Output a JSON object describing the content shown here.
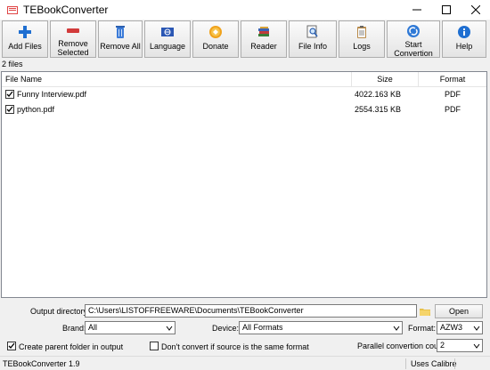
{
  "window": {
    "title": "TEBookConverter",
    "icons": [
      "app-icon",
      "minimize-icon",
      "maximize-icon",
      "close-icon"
    ]
  },
  "toolbar": {
    "add_files": "Add Files",
    "remove_selected_line1": "Remove",
    "remove_selected_line2": "Selected",
    "remove_all": "Remove All",
    "language": "Language",
    "donate": "Donate",
    "reader": "Reader",
    "file_info": "File Info",
    "logs": "Logs",
    "start_conversion": "Start Convertion",
    "help": "Help"
  },
  "file_count": "2 files",
  "list": {
    "columns": {
      "name": "File Name",
      "size": "Size",
      "format": "Format"
    },
    "rows": [
      {
        "name": "Funny Interview.pdf",
        "size": "4022.163 KB",
        "format": "PDF",
        "checked": true
      },
      {
        "name": "python.pdf",
        "size": "2554.315 KB",
        "format": "PDF",
        "checked": true
      }
    ]
  },
  "output": {
    "label": "Output directory:",
    "value": "C:\\Users\\LISTOFFREEWARE\\Documents\\TEBookConverter",
    "open_label": "Open"
  },
  "brand": {
    "label": "Brand:",
    "value": "All"
  },
  "device": {
    "label": "Device:",
    "value": "All Formats"
  },
  "format": {
    "label": "Format:",
    "value": "AZW3"
  },
  "options": {
    "create_parent": "Create parent folder in output",
    "create_parent_checked": true,
    "dont_convert": "Don't convert if source is the same format",
    "dont_convert_checked": false,
    "parallel_label": "Parallel convertion count:",
    "parallel_value": "2"
  },
  "status": {
    "version": "TEBookConverter 1.9",
    "engine": "Uses Calibre"
  },
  "colors": {
    "accent_blue": "#1f6fd1",
    "remove_red": "#d23b3b",
    "titlebar": "#ffffff"
  }
}
